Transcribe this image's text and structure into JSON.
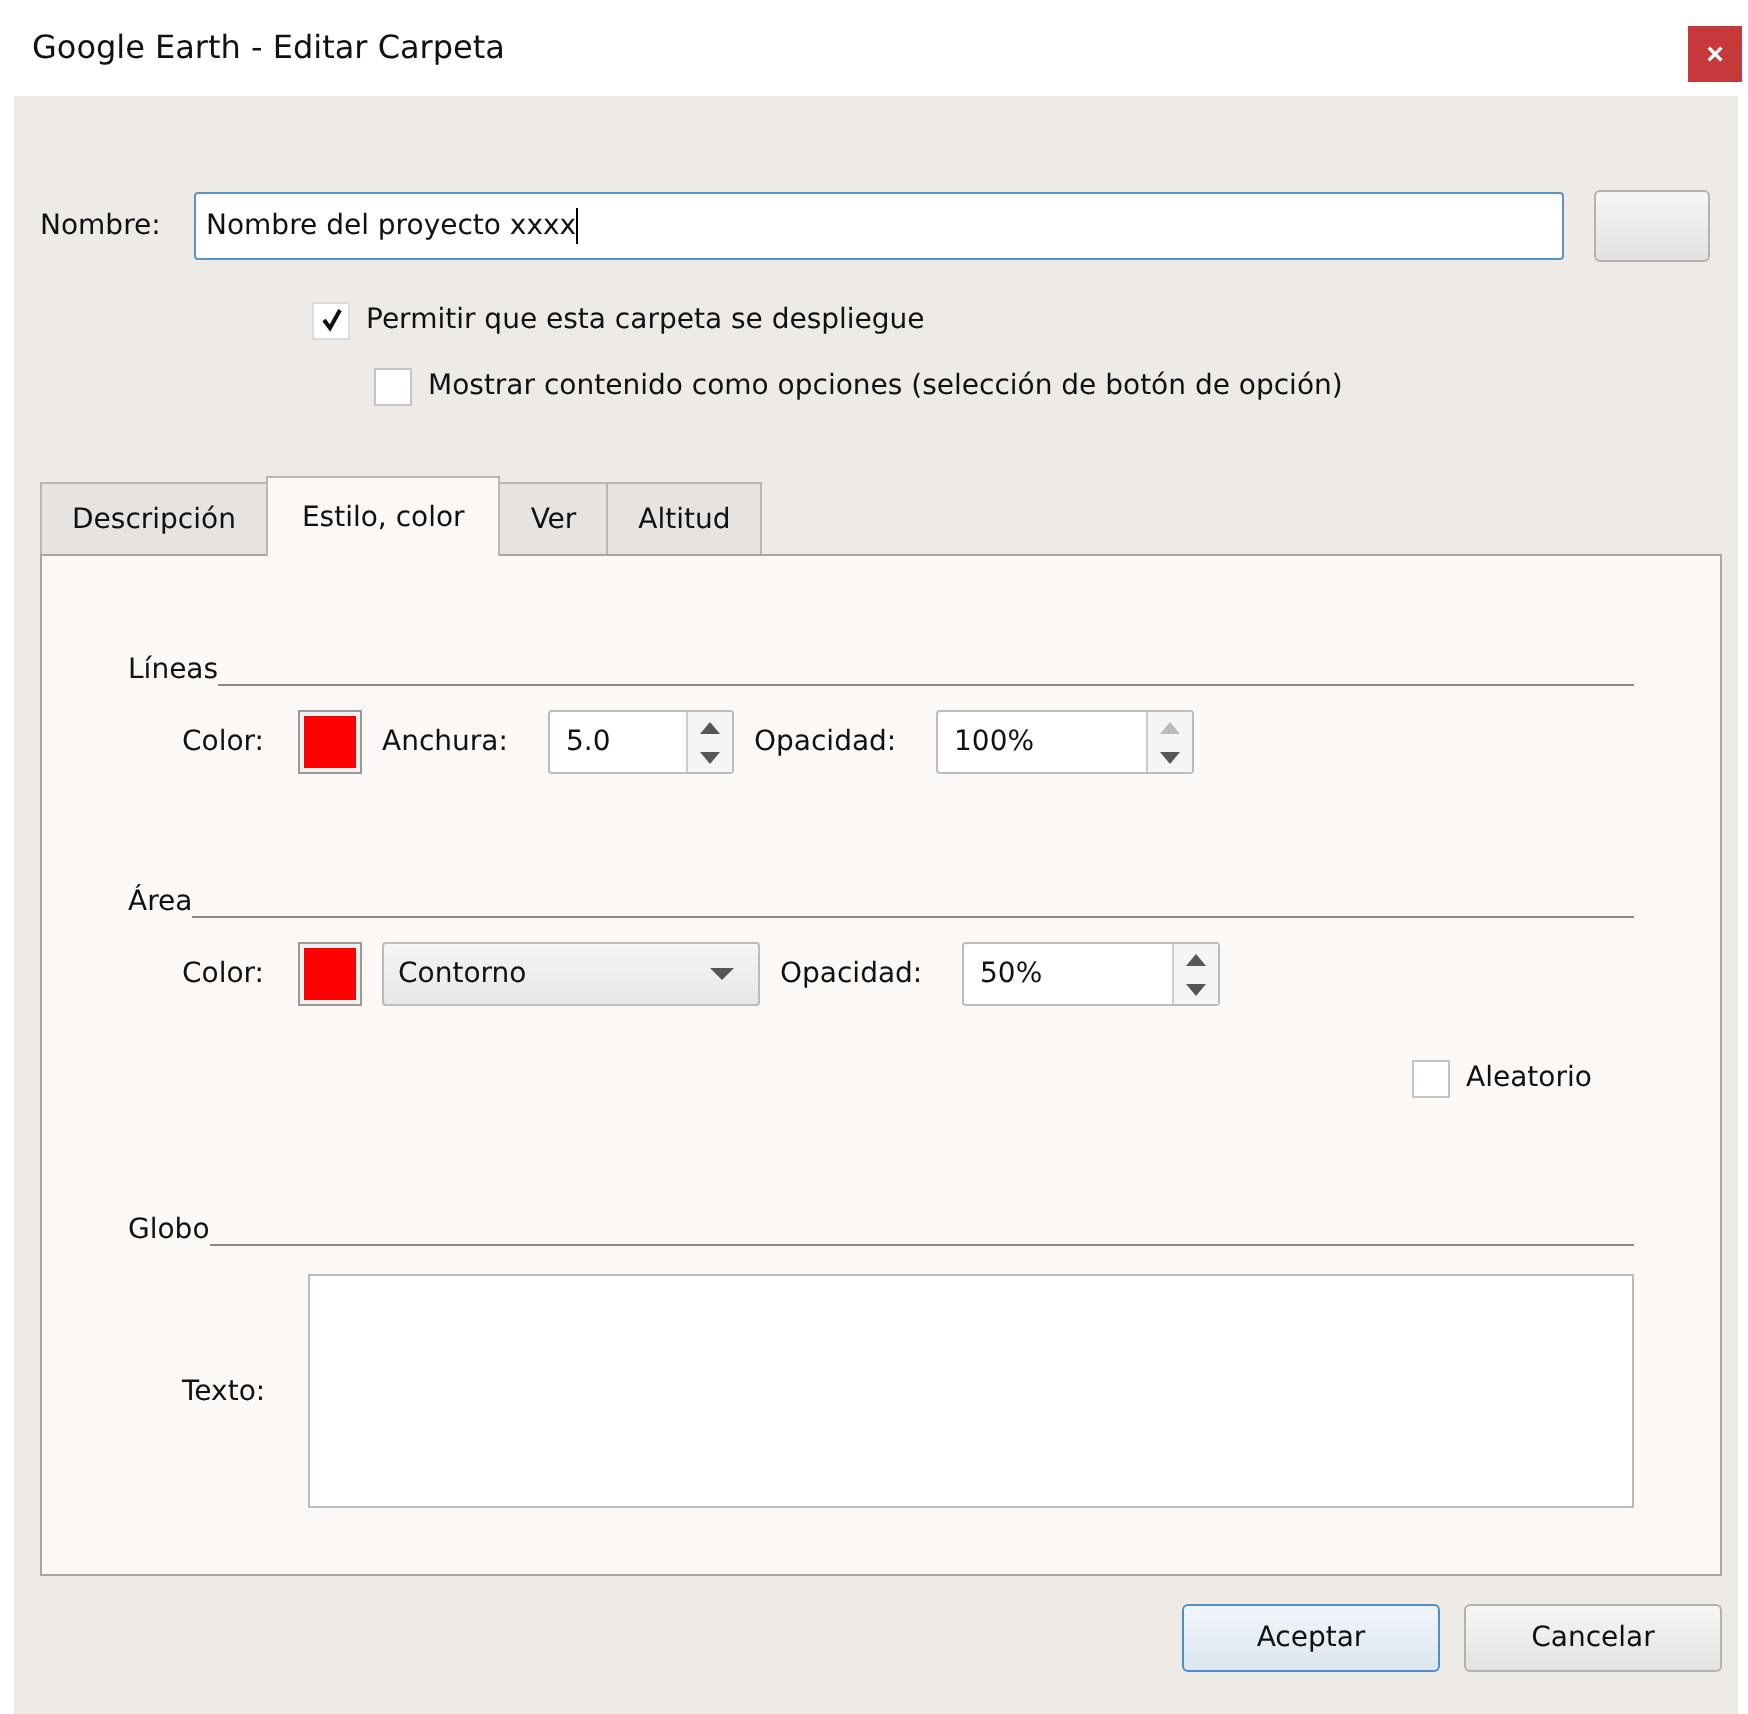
{
  "window": {
    "title": "Google Earth - Editar Carpeta",
    "close": "×"
  },
  "name_field": {
    "label": "Nombre:",
    "value": "Nombre del proyecto xxxx"
  },
  "options": [
    {
      "label": "Permitir que esta carpeta se despliegue",
      "checked": true
    },
    {
      "label": "Mostrar contenido como opciones (selección de botón de opción)",
      "checked": false
    }
  ],
  "tabs": [
    {
      "label": "Descripción",
      "selected": false
    },
    {
      "label": "Estilo, color",
      "selected": true
    },
    {
      "label": "Ver",
      "selected": false
    },
    {
      "label": "Altitud",
      "selected": false
    }
  ],
  "lines": {
    "title": "Líneas",
    "color_label": "Color:",
    "color": "#ff0000",
    "width_label": "Anchura:",
    "width": {
      "value": "5.0",
      "up_disabled": false
    },
    "opacity_label": "Opacidad:",
    "opacity": {
      "value": "100%",
      "up_disabled": true
    }
  },
  "area": {
    "title": "Área",
    "color_label": "Color:",
    "color": "#ff0000",
    "mode": "Contorno",
    "opacity_label": "Opacidad:",
    "opacity": {
      "value": "50%",
      "up_disabled": false
    },
    "random": {
      "label": "Aleatorio",
      "checked": false
    }
  },
  "globe": {
    "title": "Globo",
    "text_label": "Texto:"
  },
  "buttons": [
    {
      "label": "Aceptar",
      "default": true
    },
    {
      "label": "Cancelar",
      "default": false
    }
  ]
}
